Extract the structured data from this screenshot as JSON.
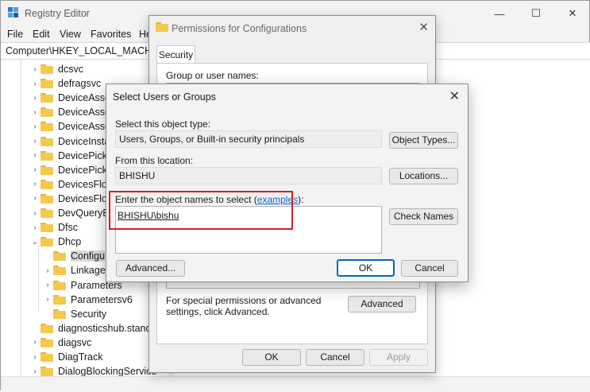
{
  "registry": {
    "title": "Registry Editor",
    "icon": "registry-icon",
    "window_buttons": {
      "minimize": "—",
      "maximize": "☐",
      "close": "✕"
    },
    "menu": [
      "File",
      "Edit",
      "View",
      "Favorites",
      "He"
    ],
    "address": "Computer\\HKEY_LOCAL_MACHIN",
    "tree": [
      {
        "label": "dcsvc",
        "expand": "›"
      },
      {
        "label": "defragsvc",
        "expand": "›"
      },
      {
        "label": "DeviceAsso",
        "expand": "›"
      },
      {
        "label": "DeviceAsso",
        "expand": "›"
      },
      {
        "label": "DeviceAsso",
        "expand": "›"
      },
      {
        "label": "DeviceInsta",
        "expand": "›"
      },
      {
        "label": "DevicePicke",
        "expand": "›"
      },
      {
        "label": "DevicePicke",
        "expand": "›"
      },
      {
        "label": "DevicesFlov",
        "expand": "›"
      },
      {
        "label": "DevicesFlov",
        "expand": "›"
      },
      {
        "label": "DevQueryB",
        "expand": "›"
      },
      {
        "label": "Dfsc",
        "expand": "›"
      },
      {
        "label": "Dhcp",
        "expand": "⌄"
      },
      {
        "label": "Configu",
        "expand": ""
      },
      {
        "label": "Linkage",
        "expand": "›"
      },
      {
        "label": "Parameters",
        "expand": "›"
      },
      {
        "label": "Parametersv6",
        "expand": "›"
      },
      {
        "label": "Security",
        "expand": ""
      },
      {
        "label": "diagnosticshub.stand",
        "expand": ""
      },
      {
        "label": "diagsvc",
        "expand": "›"
      },
      {
        "label": "DiagTrack",
        "expand": "›"
      },
      {
        "label": "DialogBlockingService",
        "expand": "›"
      }
    ]
  },
  "permissions": {
    "title": "Permissions for Configurations",
    "tab": "Security",
    "group_label": "Group or user names:",
    "special_text": "For special permissions or advanced settings, click Advanced.",
    "advanced_label": "Advanced",
    "ok_label": "OK",
    "cancel_label": "Cancel",
    "apply_label": "Apply"
  },
  "select_users": {
    "title": "Select Users or Groups",
    "object_type_label": "Select this object type:",
    "object_type_value": "Users, Groups, or Built-in security principals",
    "object_types_button": "Object Types...",
    "location_label": "From this location:",
    "location_value": "BHISHU",
    "locations_button": "Locations...",
    "names_label_prefix": "Enter the object names to select (",
    "names_label_link": "examples",
    "names_label_suffix": "):",
    "names_value": "BHISHU\\bishu",
    "check_names_button": "Check Names",
    "advanced_button": "Advanced...",
    "ok_button": "OK",
    "cancel_button": "Cancel",
    "close_icon": "✕",
    "highlight_color": "#d0202b"
  }
}
